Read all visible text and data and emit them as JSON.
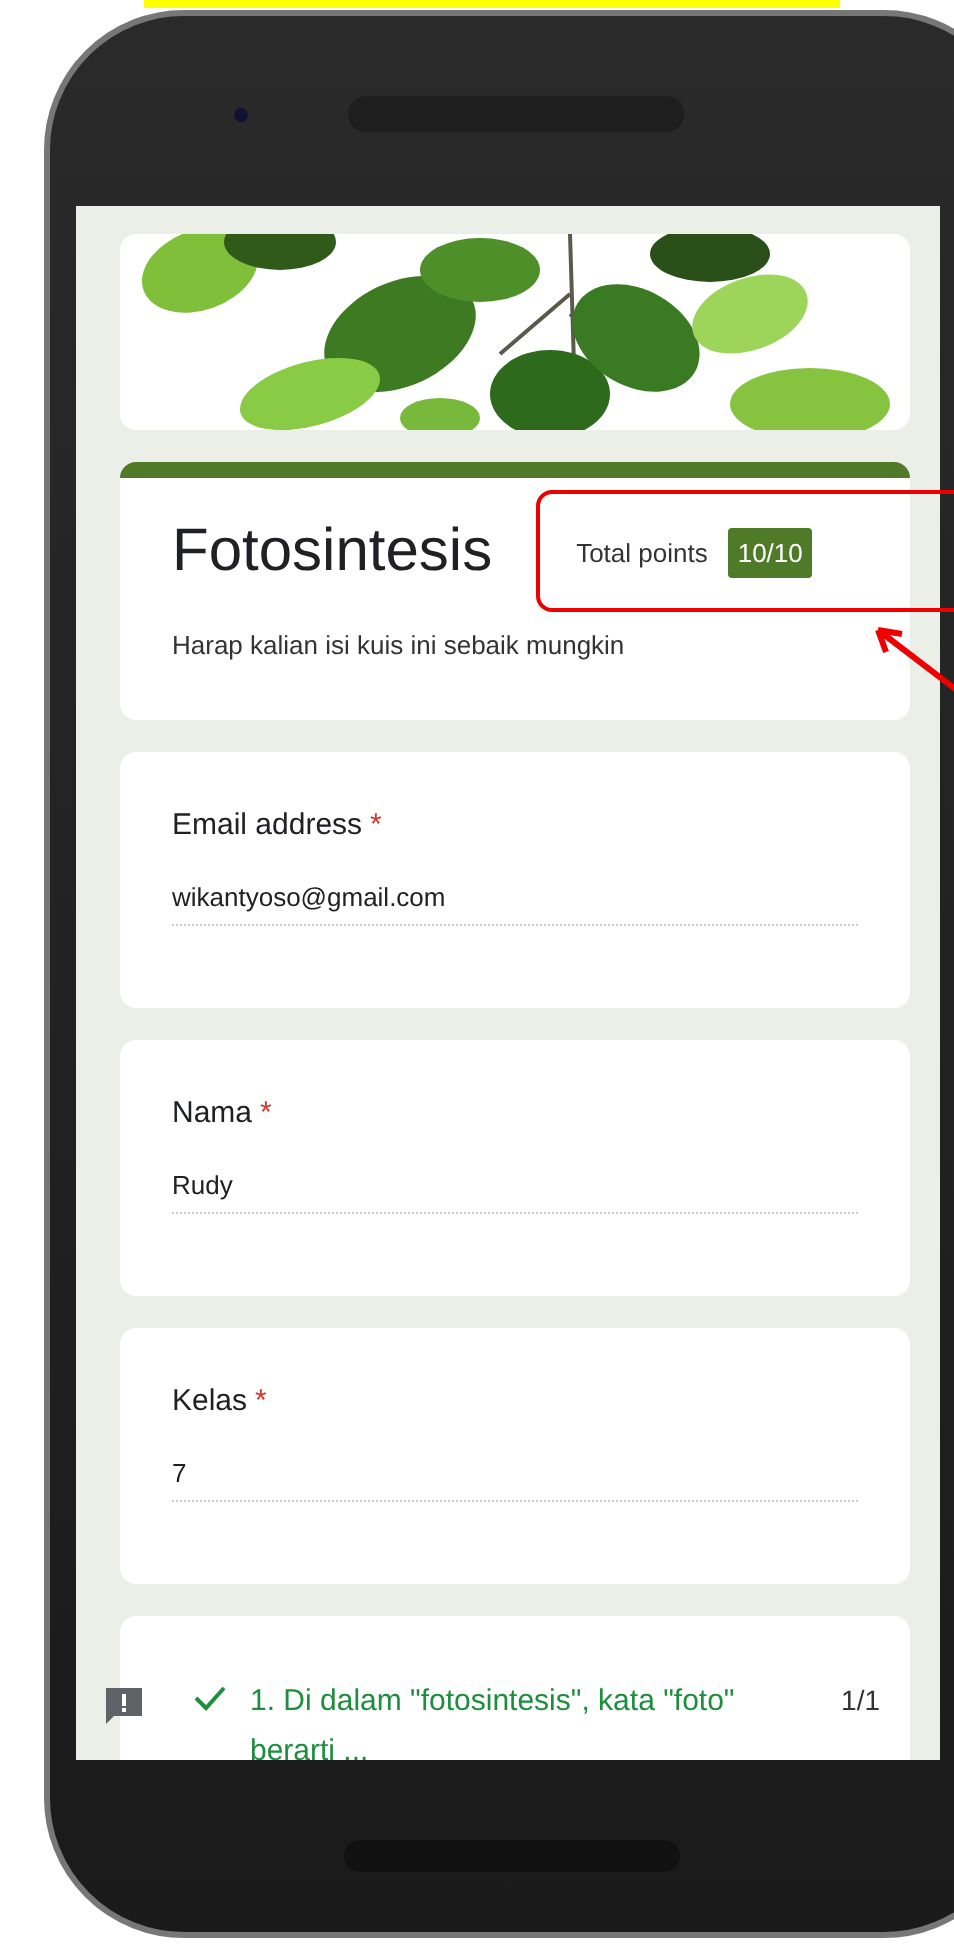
{
  "form": {
    "title": "Fotosintesis",
    "total_points_label": "Total points",
    "score": "10/10",
    "description": "Harap kalian isi kuis ini sebaik mungkin"
  },
  "fields": [
    {
      "label": "Email address",
      "required_mark": "*",
      "value": "wikantyoso@gmail.com"
    },
    {
      "label": "Nama",
      "required_mark": "*",
      "value": "Rudy"
    },
    {
      "label": "Kelas",
      "required_mark": "*",
      "value": "7"
    }
  ],
  "questions": [
    {
      "text": "1. Di dalam \"fotosintesis\", kata \"foto\" berarti ...",
      "points": "1/1",
      "correct": true
    }
  ]
}
